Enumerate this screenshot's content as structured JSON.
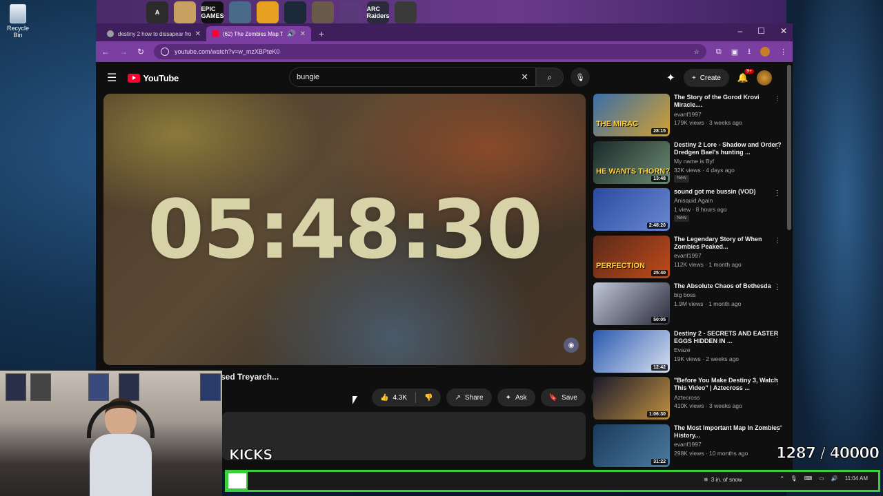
{
  "desktop": {
    "recycle_bin": "Recycle Bin",
    "dock_apps": [
      "A",
      "",
      "EPIC GAMES",
      "",
      "",
      "",
      "",
      "",
      "ARC Raiders",
      ""
    ]
  },
  "browser": {
    "tabs": [
      {
        "title": "destiny 2 how to dissapear fro..."
      },
      {
        "title": "(62) The Zombies Map That..."
      }
    ],
    "url": "youtube.com/watch?v=w_mzXBPteK0",
    "window_controls": [
      "–",
      "☐",
      "✕"
    ]
  },
  "youtube": {
    "logo": "YouTube",
    "search_value": "bungie",
    "create_label": "Create",
    "notif_badge": "9+"
  },
  "player": {
    "timer": "05:48:30"
  },
  "video": {
    "title_fragment": "sed Treyarch...",
    "likes": "4.3K",
    "share": "Share",
    "ask": "Ask",
    "save": "Save"
  },
  "sidebar": [
    {
      "title": "The Story of the Gorod Krovi Miracle....",
      "channel": "evanf1997",
      "meta": "179K views · 3 weeks ago",
      "duration": "28:15",
      "thumb_text": "THE MIRAC",
      "new": false,
      "colors": [
        "#3a6ea8",
        "#d4a030"
      ]
    },
    {
      "title": "Destiny 2 Lore - Shadow and Order? Dredgen Bael's hunting ...",
      "channel": "My name is Byf",
      "meta": "32K views · 4 days ago",
      "duration": "13:48",
      "thumb_text": "HE WANTS THORN?",
      "new": true,
      "colors": [
        "#1c2a2a",
        "#6a8a70"
      ]
    },
    {
      "title": "sound got me bussin (VOD)",
      "channel": "Anisquid Again",
      "meta": "1 view · 8 hours ago",
      "duration": "2:48:20",
      "thumb_text": "",
      "new": true,
      "colors": [
        "#2a4aa0",
        "#6a88d0"
      ]
    },
    {
      "title": "The Legendary Story of When Zombies Peaked...",
      "channel": "evanf1997",
      "meta": "112K views · 1 month ago",
      "duration": "25:40",
      "thumb_text": "PERFECTION",
      "new": false,
      "colors": [
        "#5a2a1a",
        "#c04a1a"
      ]
    },
    {
      "title": "The Absolute Chaos of Bethesda",
      "channel": "big boss",
      "meta": "1.9M views · 1 month ago",
      "duration": "50:05",
      "thumb_text": "",
      "new": false,
      "colors": [
        "#c0c8d8",
        "#2a2a3a"
      ]
    },
    {
      "title": "Destiny 2 - SECRETS AND EASTER EGGS HIDDEN IN ...",
      "channel": "Evaze",
      "meta": "19K views · 2 weeks ago",
      "duration": "12:42",
      "thumb_text": "",
      "new": false,
      "colors": [
        "#2a5ab0",
        "#d8e0f0"
      ]
    },
    {
      "title": "\"Before You Make Destiny 3, Watch This Video\" | Aztecross ...",
      "channel": "Aztecross",
      "meta": "410K views · 3 weeks ago",
      "duration": "1:06:30",
      "thumb_text": "",
      "new": false,
      "colors": [
        "#1a1a2a",
        "#c09040"
      ]
    },
    {
      "title": "The Most Important Map In Zombies' History...",
      "channel": "evanf1997",
      "meta": "298K views · 10 months ago",
      "duration": "31:22",
      "thumb_text": "",
      "new": false,
      "colors": [
        "#1a3a5a",
        "#4a7aa0"
      ]
    }
  ],
  "overlay": {
    "kicks_label": "KICKS",
    "counter": "1287 / 40000",
    "progress_fraction": 0.032
  },
  "taskbar": {
    "weather": "3 in. of snow",
    "time": "11:04 AM"
  }
}
